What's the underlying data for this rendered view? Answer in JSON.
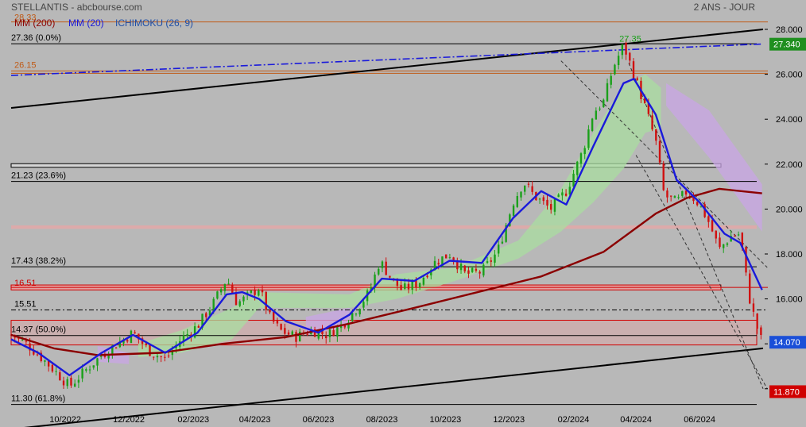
{
  "header": {
    "title": "STELLANTIS - abcbourse.com",
    "timeframe": "2 ANS - JOUR"
  },
  "legend": [
    {
      "label": "MM (200)",
      "color": "#8b0000"
    },
    {
      "label": "MM (20)",
      "color": "#1a1adb"
    },
    {
      "label": "ICHIMOKU (26, 9)",
      "color": "#1f4fa8"
    }
  ],
  "chart_data": {
    "type": "candlestick",
    "title": "STELLANTIS - abcbourse.com",
    "ylim": [
      11.3,
      28.4
    ],
    "y_ticks": [
      "28.000",
      "26.000",
      "24.000",
      "22.000",
      "20.000",
      "18.000",
      "16.000",
      "14.000",
      "12.000"
    ],
    "x_ticks": [
      "10/2022",
      "12/2022",
      "02/2023",
      "04/2023",
      "06/2023",
      "08/2023",
      "10/2023",
      "12/2023",
      "02/2024",
      "04/2024",
      "06/2024"
    ],
    "fibonacci_levels": [
      {
        "label": "27.36  (0.0%)",
        "value": 27.36
      },
      {
        "label": "21.23  (23.6%)",
        "value": 21.23
      },
      {
        "label": "17.43  (38.2%)",
        "value": 17.43
      },
      {
        "label": "14.37  (50.0%)",
        "value": 14.37
      },
      {
        "label": "11.30  (61.8%)",
        "value": 11.3
      }
    ],
    "horizontal_levels": [
      {
        "label": "28.33",
        "value": 28.33
      },
      {
        "label": "26.15",
        "value": 26.15
      },
      {
        "label": "16.51",
        "value": 16.51
      },
      {
        "label": "15.51",
        "value": 15.51
      }
    ],
    "annotations": [
      {
        "label": "27.35",
        "value": 27.35
      }
    ],
    "price_tags": [
      {
        "label": "27.340",
        "value": 27.34,
        "color": "#1f8f1f"
      },
      {
        "label": "14.070",
        "value": 14.07,
        "color": "#1a4fd8"
      },
      {
        "label": "11.870",
        "value": 11.87,
        "color": "#d00000"
      }
    ],
    "close_path": [
      [
        "2022-08-10",
        14.4
      ],
      [
        "2022-08-25",
        14.0
      ],
      [
        "2022-09-10",
        13.3
      ],
      [
        "2022-09-25",
        12.6
      ],
      [
        "2022-10-05",
        12.1
      ],
      [
        "2022-10-20",
        12.8
      ],
      [
        "2022-11-05",
        13.5
      ],
      [
        "2022-11-20",
        14.0
      ],
      [
        "2022-12-05",
        14.5
      ],
      [
        "2022-12-20",
        13.7
      ],
      [
        "2023-01-05",
        13.3
      ],
      [
        "2023-01-20",
        14.2
      ],
      [
        "2023-02-05",
        14.8
      ],
      [
        "2023-02-20",
        15.8
      ],
      [
        "2023-03-05",
        16.9
      ],
      [
        "2023-03-15",
        15.8
      ],
      [
        "2023-03-25",
        16.1
      ],
      [
        "2023-04-05",
        16.5
      ],
      [
        "2023-04-15",
        15.2
      ],
      [
        "2023-04-25",
        14.6
      ],
      [
        "2023-05-10",
        14.3
      ],
      [
        "2023-05-25",
        14.6
      ],
      [
        "2023-06-10",
        14.4
      ],
      [
        "2023-06-25",
        14.9
      ],
      [
        "2023-07-10",
        15.7
      ],
      [
        "2023-07-20",
        16.3
      ],
      [
        "2023-07-30",
        17.7
      ],
      [
        "2023-08-10",
        16.9
      ],
      [
        "2023-08-20",
        16.4
      ],
      [
        "2023-09-05",
        16.7
      ],
      [
        "2023-09-20",
        17.6
      ],
      [
        "2023-10-05",
        18.0
      ],
      [
        "2023-10-20",
        17.1
      ],
      [
        "2023-11-05",
        17.2
      ],
      [
        "2023-11-20",
        18.1
      ],
      [
        "2023-12-05",
        20.3
      ],
      [
        "2023-12-15",
        21.2
      ],
      [
        "2023-12-25",
        20.6
      ],
      [
        "2024-01-10",
        20.0
      ],
      [
        "2024-01-25",
        20.8
      ],
      [
        "2024-02-10",
        22.6
      ],
      [
        "2024-02-20",
        24.3
      ],
      [
        "2024-03-01",
        24.8
      ],
      [
        "2024-03-10",
        26.3
      ],
      [
        "2024-03-20",
        27.3
      ],
      [
        "2024-03-30",
        26.0
      ],
      [
        "2024-04-10",
        24.5
      ],
      [
        "2024-04-20",
        23.0
      ],
      [
        "2024-04-28",
        20.6
      ],
      [
        "2024-05-10",
        20.3
      ],
      [
        "2024-05-20",
        20.8
      ],
      [
        "2024-06-01",
        20.2
      ],
      [
        "2024-06-10",
        19.4
      ],
      [
        "2024-06-20",
        18.2
      ],
      [
        "2024-07-01",
        18.8
      ],
      [
        "2024-07-10",
        18.9
      ],
      [
        "2024-07-18",
        16.2
      ],
      [
        "2024-07-25",
        14.9
      ],
      [
        "2024-07-31",
        14.07
      ]
    ],
    "mm20": [
      [
        "2022-08-10",
        14.2
      ],
      [
        "2022-09-05",
        13.6
      ],
      [
        "2022-10-05",
        12.6
      ],
      [
        "2022-11-05",
        13.6
      ],
      [
        "2022-12-05",
        14.4
      ],
      [
        "2023-01-05",
        13.6
      ],
      [
        "2023-02-05",
        14.5
      ],
      [
        "2023-03-05",
        16.2
      ],
      [
        "2023-03-20",
        16.3
      ],
      [
        "2023-04-05",
        16.0
      ],
      [
        "2023-05-01",
        15.0
      ],
      [
        "2023-06-01",
        14.5
      ],
      [
        "2023-07-01",
        15.3
      ],
      [
        "2023-08-01",
        16.9
      ],
      [
        "2023-09-01",
        16.8
      ],
      [
        "2023-10-05",
        17.7
      ],
      [
        "2023-11-05",
        17.6
      ],
      [
        "2023-12-05",
        19.6
      ],
      [
        "2024-01-01",
        20.8
      ],
      [
        "2024-01-25",
        20.2
      ],
      [
        "2024-02-20",
        22.8
      ],
      [
        "2024-03-20",
        25.6
      ],
      [
        "2024-03-30",
        25.8
      ],
      [
        "2024-04-20",
        24.2
      ],
      [
        "2024-05-10",
        21.3
      ],
      [
        "2024-06-01",
        20.3
      ],
      [
        "2024-06-25",
        18.9
      ],
      [
        "2024-07-10",
        18.5
      ],
      [
        "2024-07-31",
        16.4
      ]
    ],
    "mm200": [
      [
        "2022-08-10",
        14.4
      ],
      [
        "2022-09-20",
        13.8
      ],
      [
        "2022-11-01",
        13.5
      ],
      [
        "2023-01-01",
        13.6
      ],
      [
        "2023-03-01",
        14.0
      ],
      [
        "2023-05-01",
        14.3
      ],
      [
        "2023-07-01",
        14.9
      ],
      [
        "2023-09-01",
        15.6
      ],
      [
        "2023-11-01",
        16.3
      ],
      [
        "2024-01-01",
        17.0
      ],
      [
        "2024-03-01",
        18.1
      ],
      [
        "2024-04-20",
        19.8
      ],
      [
        "2024-05-20",
        20.5
      ],
      [
        "2024-06-20",
        20.9
      ],
      [
        "2024-07-31",
        20.7
      ]
    ],
    "ichimoku_bull_cloud": [
      [
        "2022-12-10",
        13.4,
        14.0
      ],
      [
        "2023-01-20",
        13.6,
        14.6
      ],
      [
        "2023-03-10",
        14.2,
        15.6
      ],
      [
        "2023-04-05",
        15.6,
        16.3
      ],
      [
        "2023-07-01",
        15.6,
        16.2
      ],
      [
        "2023-08-15",
        16.0,
        17.1
      ],
      [
        "2023-10-10",
        16.8,
        17.4
      ],
      [
        "2023-12-10",
        17.8,
        18.6
      ],
      [
        "2024-01-20",
        19.0,
        20.9
      ],
      [
        "2024-02-20",
        20.3,
        23.4
      ],
      [
        "2024-03-20",
        21.8,
        25.5
      ],
      [
        "2024-04-10",
        23.4,
        26.0
      ],
      [
        "2024-04-25",
        23.6,
        25.4
      ]
    ],
    "ichimoku_bear_cloud": [
      [
        "2022-11-01",
        13.2,
        13.9
      ],
      [
        "2022-12-01",
        13.1,
        13.6
      ],
      [
        "2023-05-20",
        14.4,
        15.2
      ],
      [
        "2023-07-01",
        14.8,
        15.6
      ],
      [
        "2024-04-30",
        24.6,
        25.6
      ],
      [
        "2024-06-10",
        22.3,
        24.4
      ],
      [
        "2024-07-31",
        19.0,
        21.1
      ]
    ],
    "trendlines": [
      {
        "name": "upper",
        "from": [
          "2022-08-10",
          24.5
        ],
        "to": [
          "2024-08-01",
          28.0
        ]
      },
      {
        "name": "lower",
        "from": [
          "2022-08-10",
          10.2
        ],
        "to": [
          "2024-08-01",
          13.8
        ]
      },
      {
        "name": "blue-dashdot",
        "from": [
          "2022-08-10",
          25.95
        ],
        "to": [
          "2024-08-01",
          27.35
        ]
      },
      {
        "name": "channel-1",
        "from": [
          "2024-01-20",
          26.6
        ],
        "to": [
          "2024-08-05",
          17.4
        ]
      },
      {
        "name": "channel-2",
        "from": [
          "2024-03-25",
          26.5
        ],
        "to": [
          "2024-08-01",
          12.0
        ]
      },
      {
        "name": "channel-3",
        "from": [
          "2024-04-01",
          22.4
        ],
        "to": [
          "2024-08-05",
          12.0
        ]
      }
    ]
  }
}
